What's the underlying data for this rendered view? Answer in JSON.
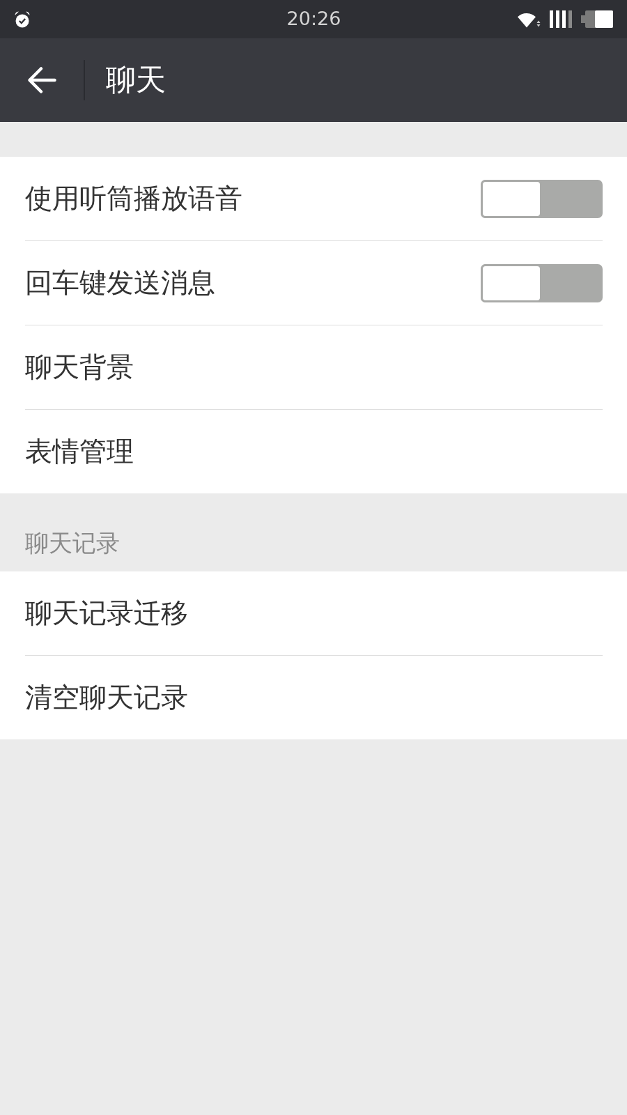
{
  "status_bar": {
    "time": "20:26"
  },
  "header": {
    "title": "聊天"
  },
  "groups": [
    {
      "items": [
        {
          "kind": "switch",
          "label": "使用听筒播放语音",
          "on": false
        },
        {
          "kind": "switch",
          "label": "回车键发送消息",
          "on": false
        },
        {
          "kind": "link",
          "label": "聊天背景"
        },
        {
          "kind": "link",
          "label": "表情管理"
        }
      ]
    },
    {
      "heading": "聊天记录",
      "items": [
        {
          "kind": "link",
          "label": "聊天记录迁移"
        },
        {
          "kind": "link",
          "label": "清空聊天记录"
        }
      ]
    }
  ]
}
